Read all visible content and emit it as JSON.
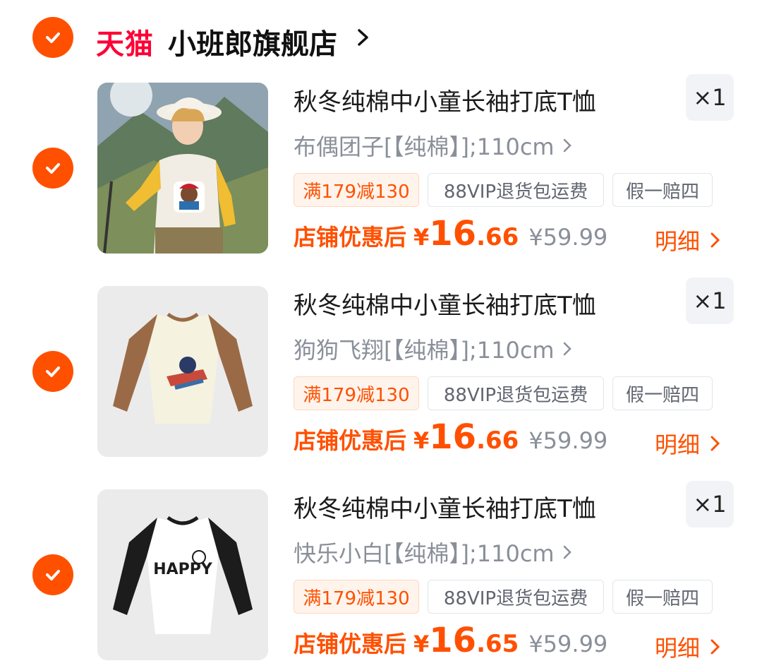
{
  "store": {
    "brand": "天猫",
    "name": "小班郎旗舰店"
  },
  "items": [
    {
      "title": "秋冬纯棉中小童长袖打底T恤",
      "sku": "布偶团子[【纯棉】];110cm",
      "quantity": "×1",
      "tags": [
        "满179减130",
        "88VIP退货包运费",
        "假一赔四"
      ],
      "price_label": "店铺优惠后",
      "currency": "¥",
      "price_int": "16",
      "price_dec": ".66",
      "original_price": "¥59.99",
      "detail_label": "明细"
    },
    {
      "title": "秋冬纯棉中小童长袖打底T恤",
      "sku": "狗狗飞翔[【纯棉】];110cm",
      "quantity": "×1",
      "tags": [
        "满179减130",
        "88VIP退货包运费",
        "假一赔四"
      ],
      "price_label": "店铺优惠后",
      "currency": "¥",
      "price_int": "16",
      "price_dec": ".66",
      "original_price": "¥59.99",
      "detail_label": "明细"
    },
    {
      "title": "秋冬纯棉中小童长袖打底T恤",
      "sku": "快乐小白[【纯棉】];110cm",
      "quantity": "×1",
      "tags": [
        "满179减130",
        "88VIP退货包运费",
        "假一赔四"
      ],
      "price_label": "店铺优惠后",
      "currency": "¥",
      "price_int": "16",
      "price_dec": ".65",
      "original_price": "¥59.99",
      "detail_label": "明细",
      "image_text": "HAPPY"
    }
  ],
  "colors": {
    "accent": "#ff5000",
    "tmall": "#ff0036",
    "muted": "#8a8f99"
  }
}
